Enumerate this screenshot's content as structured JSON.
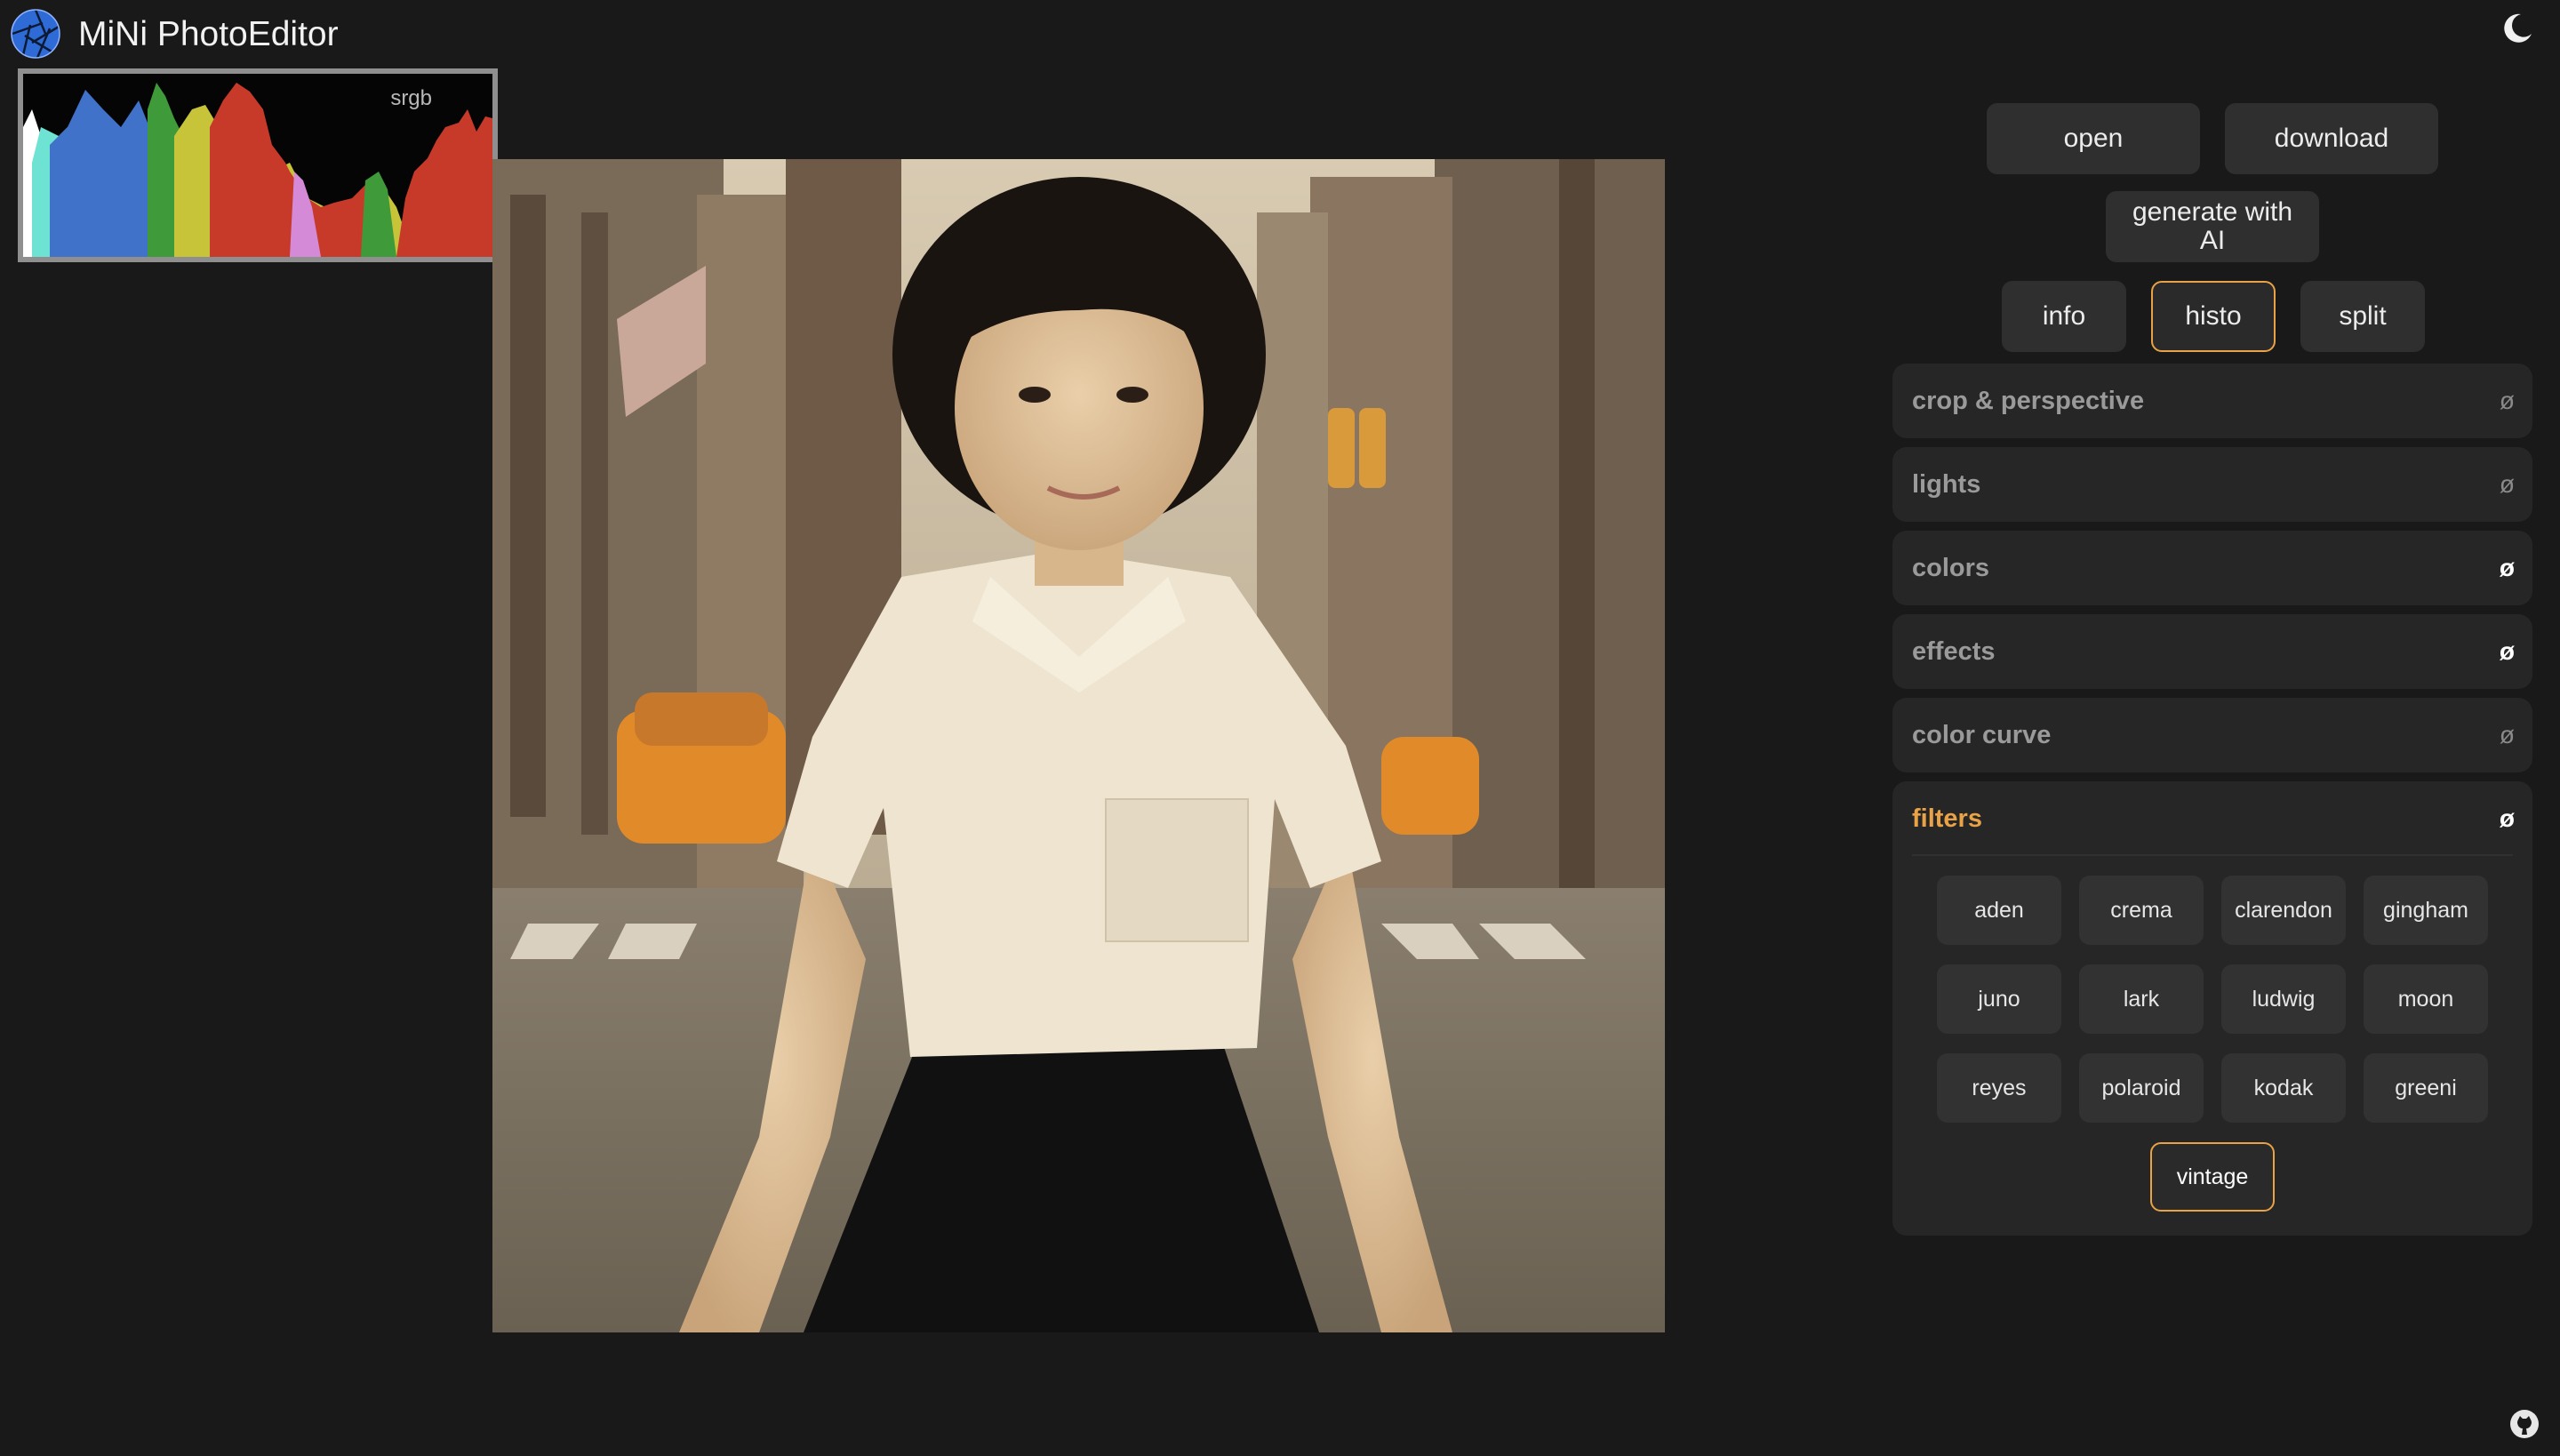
{
  "app": {
    "title": "MiNi PhotoEditor"
  },
  "icons": {
    "logo": "aperture-logo-icon",
    "theme": "moon-icon",
    "github": "github-icon"
  },
  "histogram": {
    "label": "srgb"
  },
  "toolbar": {
    "open": "open",
    "download": "download",
    "generate": "generate with AI"
  },
  "view_tabs": [
    {
      "label": "info",
      "active": false
    },
    {
      "label": "histo",
      "active": true
    },
    {
      "label": "split",
      "active": false
    }
  ],
  "sections": [
    {
      "title": "crop & perspective",
      "reset": "ø",
      "modified": false
    },
    {
      "title": "lights",
      "reset": "ø",
      "modified": false
    },
    {
      "title": "colors",
      "reset": "ø",
      "modified": true
    },
    {
      "title": "effects",
      "reset": "ø",
      "modified": true
    },
    {
      "title": "color curve",
      "reset": "ø",
      "modified": false
    }
  ],
  "filters": {
    "title": "filters",
    "reset": "ø",
    "selected": "vintage",
    "items": [
      "aden",
      "crema",
      "clarendon",
      "gingham",
      "juno",
      "lark",
      "ludwig",
      "moon",
      "reyes",
      "polaroid",
      "kodak",
      "greeni",
      "vintage"
    ]
  },
  "colors": {
    "accent": "#e9a346",
    "background": "#191919",
    "panel": "#262626",
    "button": "#2f2f2f"
  }
}
